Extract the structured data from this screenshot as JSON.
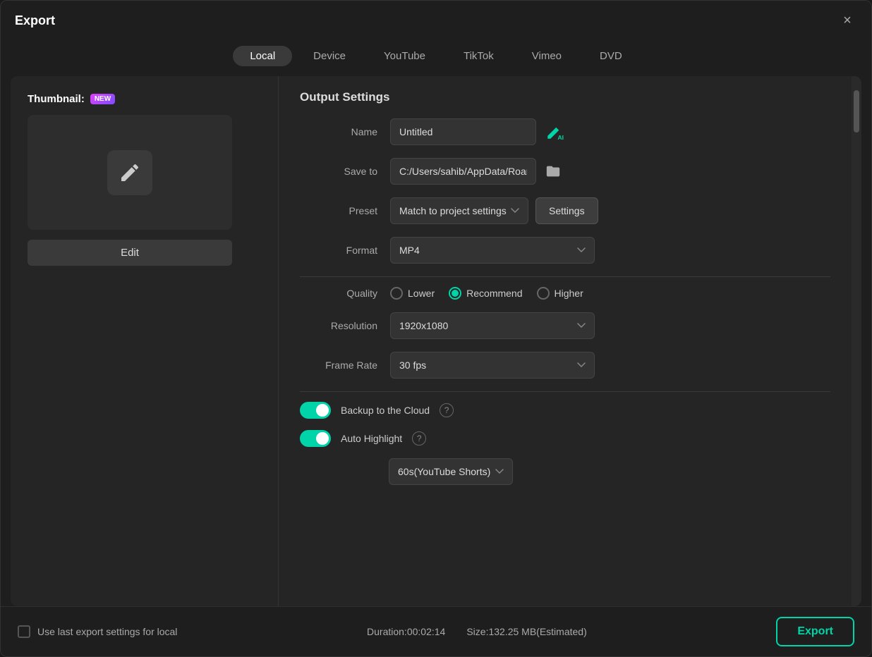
{
  "dialog": {
    "title": "Export",
    "close_label": "×"
  },
  "tabs": [
    {
      "id": "local",
      "label": "Local",
      "active": true
    },
    {
      "id": "device",
      "label": "Device",
      "active": false
    },
    {
      "id": "youtube",
      "label": "YouTube",
      "active": false
    },
    {
      "id": "tiktok",
      "label": "TikTok",
      "active": false
    },
    {
      "id": "vimeo",
      "label": "Vimeo",
      "active": false
    },
    {
      "id": "dvd",
      "label": "DVD",
      "active": false
    }
  ],
  "left_panel": {
    "thumbnail_label": "Thumbnail:",
    "new_badge": "NEW",
    "edit_button": "Edit"
  },
  "output_settings": {
    "section_title": "Output Settings",
    "name_label": "Name",
    "name_value": "Untitled",
    "save_to_label": "Save to",
    "save_to_value": "C:/Users/sahib/AppData/Roan",
    "preset_label": "Preset",
    "preset_value": "Match to project settings",
    "settings_button": "Settings",
    "format_label": "Format",
    "format_value": "MP4",
    "quality_label": "Quality",
    "quality_options": [
      {
        "id": "lower",
        "label": "Lower",
        "checked": false
      },
      {
        "id": "recommend",
        "label": "Recommend",
        "checked": true
      },
      {
        "id": "higher",
        "label": "Higher",
        "checked": false
      }
    ],
    "resolution_label": "Resolution",
    "resolution_value": "1920x1080",
    "frame_rate_label": "Frame Rate",
    "frame_rate_value": "30 fps",
    "backup_label": "Backup to the Cloud",
    "backup_on": true,
    "auto_highlight_label": "Auto Highlight",
    "auto_highlight_on": true,
    "highlight_duration": "60s(YouTube Shorts)"
  },
  "bottom_bar": {
    "checkbox_label": "Use last export settings for local",
    "duration_label": "Duration:00:02:14",
    "size_label": "Size:132.25 MB(Estimated)",
    "export_button": "Export"
  }
}
